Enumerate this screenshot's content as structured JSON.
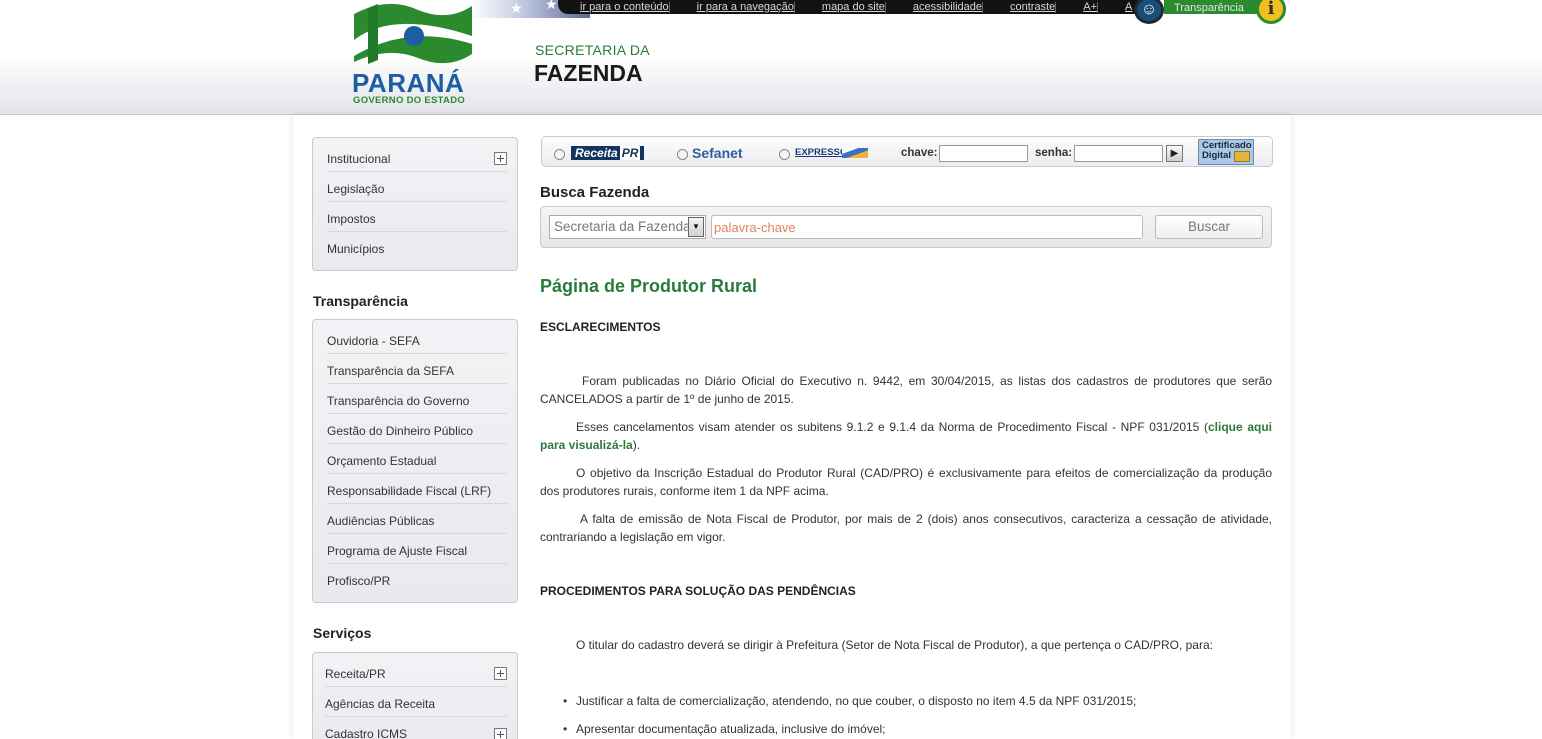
{
  "access_bar": {
    "links": [
      "ir para o conteúdo",
      "ir para a navegação",
      "mapa do site",
      "acessibilidade",
      "contraste",
      "A+",
      "A"
    ],
    "transparencia": "Transparência",
    "a11y_icon": "accessibility-icon",
    "info_icon": "info-icon"
  },
  "logo": {
    "name": "PARANÁ",
    "sub": "GOVERNO DO ESTADO"
  },
  "brand": {
    "line1": "SECRETARIA DA",
    "line2": "FAZENDA"
  },
  "sidebar": {
    "menu1": [
      {
        "label": "Institucional",
        "expandable": true
      },
      {
        "label": "Legislação",
        "expandable": false
      },
      {
        "label": "Impostos",
        "expandable": false
      },
      {
        "label": "Municípios",
        "expandable": false
      }
    ],
    "transparencia_title": "Transparência",
    "menu2": [
      "Ouvidoria - SEFA",
      "Transparência da SEFA",
      "Transparência do Governo",
      "Gestão do Dinheiro Público",
      "Orçamento Estadual",
      "Responsabilidade Fiscal (LRF)",
      "Audiências Públicas",
      "Programa de Ajuste Fiscal",
      "Profisco/PR"
    ],
    "servicos_title": "Serviços",
    "menu3": [
      {
        "label": "Receita/PR",
        "expandable": true
      },
      {
        "label": "Agências da Receita",
        "expandable": false
      },
      {
        "label": "Cadastro ICMS",
        "expandable": true
      }
    ]
  },
  "login": {
    "receita_a": "Receita",
    "receita_b": "PR",
    "sefanet": "Sefanet",
    "expresso": "EXPRESSO",
    "chave_label": "chave:",
    "senha_label": "senha:",
    "go": "▶",
    "cert_line1": "Certificado",
    "cert_line2": "Digital"
  },
  "search": {
    "title": "Busca Fazenda",
    "select_value": "Secretaria da Fazenda",
    "placeholder": "palavra-chave",
    "button": "Buscar"
  },
  "content": {
    "title": "Página de Produtor Rural",
    "section1": "ESCLARECIMENTOS",
    "p1": "Foram publicadas no Diário Oficial do Executivo n. 9442, em 30/04/2015, as listas dos cadastros de produtores que serão CANCELADOS a partir de 1º de junho de 2015.",
    "p2_start": "Esses cancelamentos visam atender os subitens 9.1.2 e 9.1.4 da Norma de Procedimento Fiscal - NPF 031/2015 (",
    "p2_link": "clique aqui para visualizá-la",
    "p2_end": ").",
    "p3": "O objetivo da Inscrição Estadual do Produtor Rural (CAD/PRO) é exclusivamente para efeitos de comercialização da produção dos produtores rurais, conforme item 1 da NPF acima.",
    "p4": "A falta de emissão de Nota Fiscal de Produtor, por mais de 2 (dois) anos consecutivos, caracteriza a cessação de atividade, contrariando a legislação em vigor.",
    "section2": "PROCEDIMENTOS PARA SOLUÇÃO DAS PENDÊNCIAS",
    "p5": "O titular do cadastro deverá se dirigir à Prefeitura (Setor de Nota Fiscal de Produtor), a que pertença o CAD/PRO, para:",
    "bullet1": "Justificar a falta de comercialização, atendendo, no que couber, o disposto no item 4.5 da NPF 031/2015;",
    "bullet2": "Apresentar documentação atualizada, inclusive do imóvel;"
  }
}
